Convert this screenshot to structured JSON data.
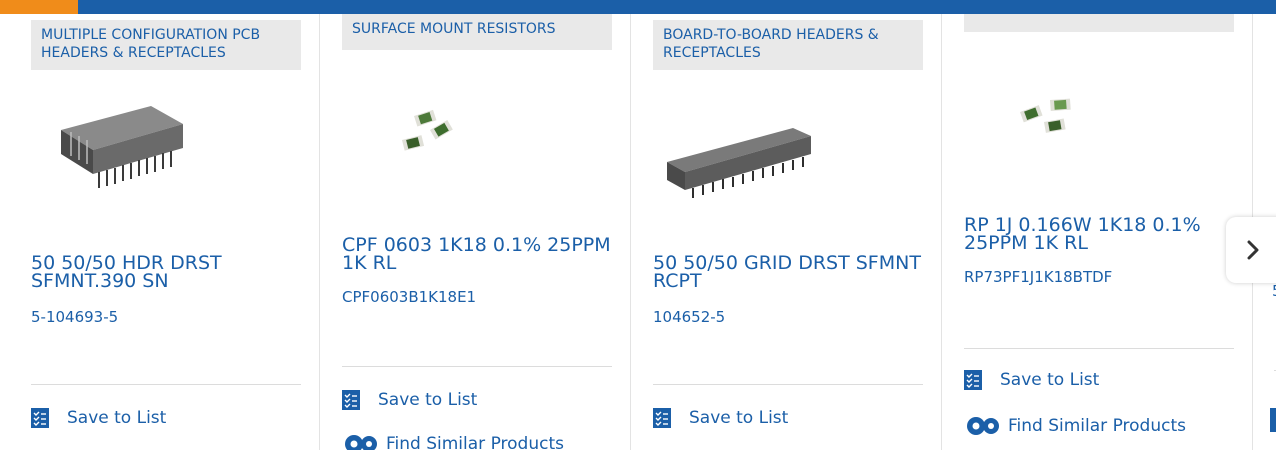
{
  "colors": {
    "brand_blue": "#1b5fa8",
    "accent_orange": "#f08c1a",
    "category_bg": "#e9e9e9",
    "divider": "#dcdcdc"
  },
  "cards": [
    {
      "category": "MULTIPLE CONFIGURATION PCB HEADERS & RECEPTACLES",
      "title": "50 50/50 HDR DRST SFMNT.390 SN",
      "part_number": "5-104693-5",
      "save_label": "Save to List",
      "find_label": "",
      "image_icon": "pcb-header-icon"
    },
    {
      "category": "SURFACE MOUNT RESISTORS",
      "title": "CPF 0603 1K18 0.1% 25PPM 1K RL",
      "part_number": "CPF0603B1K18E1",
      "save_label": "Save to List",
      "find_label": "Find Similar Products",
      "image_icon": "smd-resistor-icon"
    },
    {
      "category": "BOARD-TO-BOARD HEADERS & RECEPTACLES",
      "title": "50 50/50 GRID DRST SFMNT RCPT",
      "part_number": "104652-5",
      "save_label": "Save to List",
      "find_label": "",
      "image_icon": "board-connector-icon"
    },
    {
      "category": "",
      "title": "RP 1J 0.166W 1K18 0.1% 25PPM 1K RL",
      "part_number": "RP73PF1J1K18BTDF",
      "save_label": "Save to List",
      "find_label": "Find Similar Products",
      "image_icon": "smd-resistor-icon"
    }
  ],
  "partial_card": {
    "part_fragment": "5"
  },
  "carousel": {
    "next_icon": "chevron-right-icon"
  }
}
